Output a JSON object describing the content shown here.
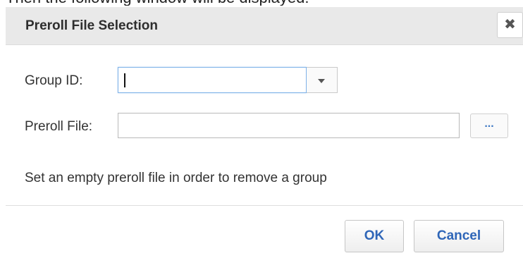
{
  "background": {
    "cut_off_text": "Then the following window will be displayed:"
  },
  "dialog": {
    "title": "Preroll File Selection",
    "close_icon": "close-icon",
    "close_glyph": "✖",
    "group_id": {
      "label": "Group ID:",
      "value": "",
      "dropdown_icon": "chevron-down-icon"
    },
    "preroll_file": {
      "label": "Preroll File:",
      "value": "",
      "browse_label": "..."
    },
    "note": "Set an empty preroll file in order to remove a group",
    "buttons": {
      "ok": "OK",
      "cancel": "Cancel"
    }
  },
  "colors": {
    "titlebar_bg": "#e9e9e9",
    "button_text": "#2f66b8",
    "focus_border": "#7eb2e8"
  }
}
